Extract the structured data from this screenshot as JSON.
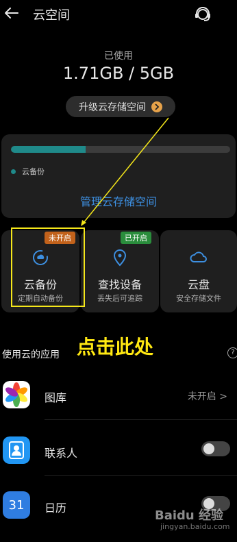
{
  "header": {
    "title": "云空间"
  },
  "usage": {
    "label": "已使用",
    "value": "1.71GB / 5GB",
    "fraction_used": 0.342,
    "upgrade_label": "升级云存储空间"
  },
  "storage_card": {
    "legend": "云备份",
    "manage_label": "管理云存储空间"
  },
  "tiles": [
    {
      "name": "云备份",
      "desc": "定期自动备份",
      "badge": "未开启"
    },
    {
      "name": "查找设备",
      "desc": "丢失后可追踪",
      "badge": "已开启"
    },
    {
      "name": "云盘",
      "desc": "安全存储文件",
      "badge": ""
    }
  ],
  "apps_section": {
    "label": "使用云的应用",
    "help": "?",
    "items": [
      {
        "label": "图库",
        "value": "未开启 >"
      },
      {
        "label": "联系人",
        "toggle": false
      },
      {
        "label": "日历",
        "toggle": false,
        "icon_text": "31"
      }
    ]
  },
  "annotation": {
    "callout": "点击此处"
  },
  "watermark": {
    "text": "Baidu 经验",
    "sub": "jingyan.baidu.com"
  },
  "colors": {
    "accent": "#3d8fe0",
    "bar": "#1f8a8a",
    "highlight": "#f5e71a",
    "badge_off": "#c2621b",
    "badge_on": "#2a8d3c"
  }
}
